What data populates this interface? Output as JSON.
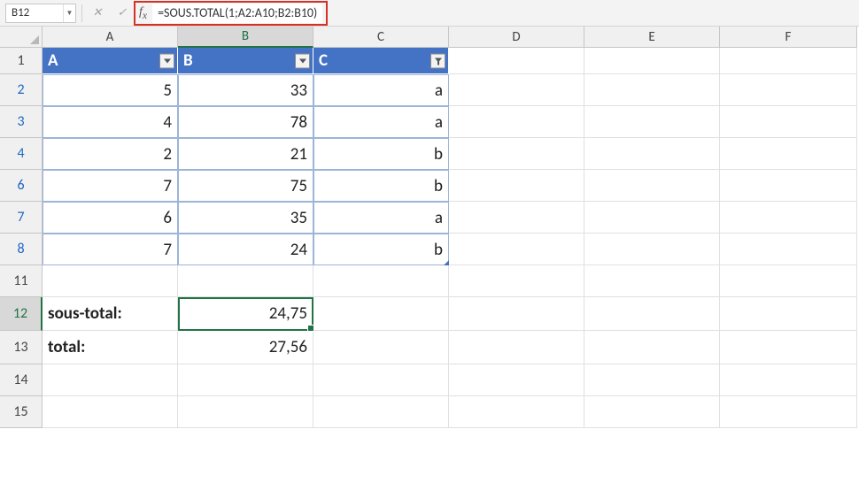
{
  "formula_bar": {
    "cell_ref": "B12",
    "formula": "=SOUS.TOTAL(1;A2:A10;B2:B10)"
  },
  "columns": [
    "A",
    "B",
    "C",
    "D",
    "E",
    "F"
  ],
  "row_numbers": [
    "1",
    "2",
    "3",
    "4",
    "6",
    "7",
    "8",
    "11",
    "12",
    "13",
    "14",
    "15"
  ],
  "table": {
    "headers": {
      "A": "A",
      "B": "B",
      "C": "C"
    },
    "rows": [
      {
        "A": "5",
        "B": "33",
        "C": "a"
      },
      {
        "A": "4",
        "B": "78",
        "C": "a"
      },
      {
        "A": "2",
        "B": "21",
        "C": "b"
      },
      {
        "A": "7",
        "B": "75",
        "C": "b"
      },
      {
        "A": "6",
        "B": "35",
        "C": "a"
      },
      {
        "A": "7",
        "B": "24",
        "C": "b"
      }
    ]
  },
  "summary": {
    "subtotal_label": "sous-total:",
    "subtotal_value": "24,75",
    "total_label": "total:",
    "total_value": "27,56"
  },
  "row_heights": {
    "header_row": 30,
    "data_row": 36,
    "summary_row": 38,
    "blank_row": 36
  },
  "chart_data": {
    "type": "table",
    "columns": [
      "A",
      "B",
      "C"
    ],
    "rows": [
      [
        5,
        33,
        "a"
      ],
      [
        4,
        78,
        "a"
      ],
      [
        2,
        21,
        "b"
      ],
      [
        7,
        75,
        "b"
      ],
      [
        6,
        35,
        "a"
      ],
      [
        7,
        24,
        "b"
      ]
    ],
    "aggregates": {
      "sous_total": 24.75,
      "total": 27.56
    }
  }
}
